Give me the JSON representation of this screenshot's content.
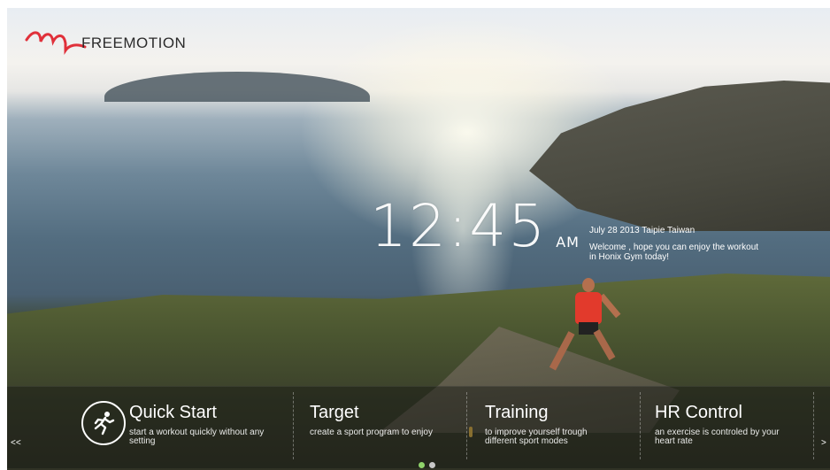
{
  "brand": {
    "name": "FREEMOTION",
    "accent_color": "#e0303a"
  },
  "clock": {
    "time": "12:45",
    "ampm": "AM"
  },
  "info": {
    "date_location": "July 28 2013  Taipie Taiwan",
    "welcome": "Welcome , hope you can enjoy the workout in Honix Gym today!"
  },
  "menu": {
    "prev_label": "<<",
    "next_label": ">",
    "items": [
      {
        "title": "Quick Start",
        "desc": "start a workout quickly without any setting",
        "icon": "runner-icon"
      },
      {
        "title": "Target",
        "desc": "create a sport program to enjoy"
      },
      {
        "title": "Training",
        "desc": "to improve yourself trough different sport modes"
      },
      {
        "title": "HR Control",
        "desc": "an exercise is controled by your heart rate"
      }
    ]
  },
  "pagination": {
    "pages": 2,
    "current": 1,
    "active_color": "#8fd36a"
  }
}
